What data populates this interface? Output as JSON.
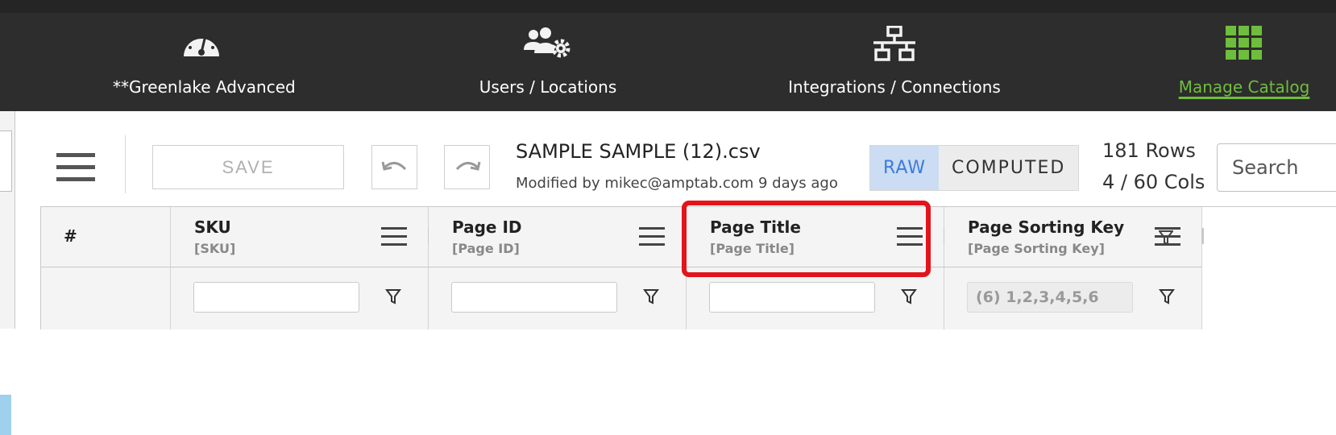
{
  "nav": {
    "items": [
      {
        "label": "**Greenlake Advanced",
        "icon": "speedometer-icon"
      },
      {
        "label": "Users / Locations",
        "icon": "users-gear-icon"
      },
      {
        "label": "Integrations / Connections",
        "icon": "network-icon"
      },
      {
        "label": "Manage Catalog",
        "icon": "grid-icon",
        "active": true
      }
    ]
  },
  "toolbar": {
    "save_label": "SAVE",
    "file_title": "SAMPLE SAMPLE (12).csv",
    "modified": "Modified by mikec@amptab.com 9 days ago",
    "raw_label": "RAW",
    "computed_label": "COMPUTED",
    "rows": "181 Rows",
    "cols": "4 / 60 Cols",
    "search_placeholder": "Search"
  },
  "table": {
    "index_header": "#",
    "columns": [
      {
        "title": "SKU",
        "key": "[SKU]",
        "filter_value": ""
      },
      {
        "title": "Page ID",
        "key": "[Page ID]",
        "filter_value": ""
      },
      {
        "title": "Page Title",
        "key": "[Page Title]",
        "filter_value": "",
        "highlighted": true
      },
      {
        "title": "Page Sorting Key",
        "key": "[Page Sorting Key]",
        "filter_value": "(6) 1,2,3,4,5,6",
        "filtered": true
      }
    ]
  },
  "colors": {
    "nav_bg": "#2d2d2d",
    "active_green": "#6fbd3c",
    "raw_active_bg": "#cbdcf3",
    "raw_active_text": "#3b7dd8",
    "highlight_red": "#e3141b"
  }
}
